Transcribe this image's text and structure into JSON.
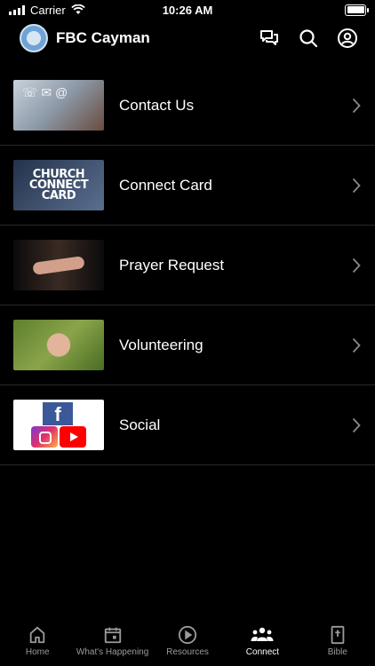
{
  "status": {
    "carrier": "Carrier",
    "time": "10:26 AM"
  },
  "header": {
    "title": "FBC Cayman",
    "icons": [
      "chat-bubbles-icon",
      "search-icon",
      "account-icon"
    ]
  },
  "items": [
    {
      "label": "Contact Us",
      "thumb": "contact-us-thumbnail"
    },
    {
      "label": "Connect Card",
      "thumb": "connect-card-thumbnail",
      "thumb_text": [
        "CHURCH",
        "CONNECT",
        "CARD"
      ]
    },
    {
      "label": "Prayer Request",
      "thumb": "prayer-request-thumbnail"
    },
    {
      "label": "Volunteering",
      "thumb": "volunteering-thumbnail"
    },
    {
      "label": "Social",
      "thumb": "social-thumbnail"
    }
  ],
  "tabs": [
    {
      "label": "Home",
      "icon": "home-icon"
    },
    {
      "label": "What's Happening",
      "icon": "calendar-icon"
    },
    {
      "label": "Resources",
      "icon": "play-circle-icon"
    },
    {
      "label": "Connect",
      "icon": "people-icon",
      "active": true
    },
    {
      "label": "Bible",
      "icon": "bible-icon"
    }
  ],
  "colors": {
    "background": "#000000",
    "text": "#ffffff",
    "inactive_tab": "#9a9a9a",
    "divider": "#2a2a2a"
  }
}
